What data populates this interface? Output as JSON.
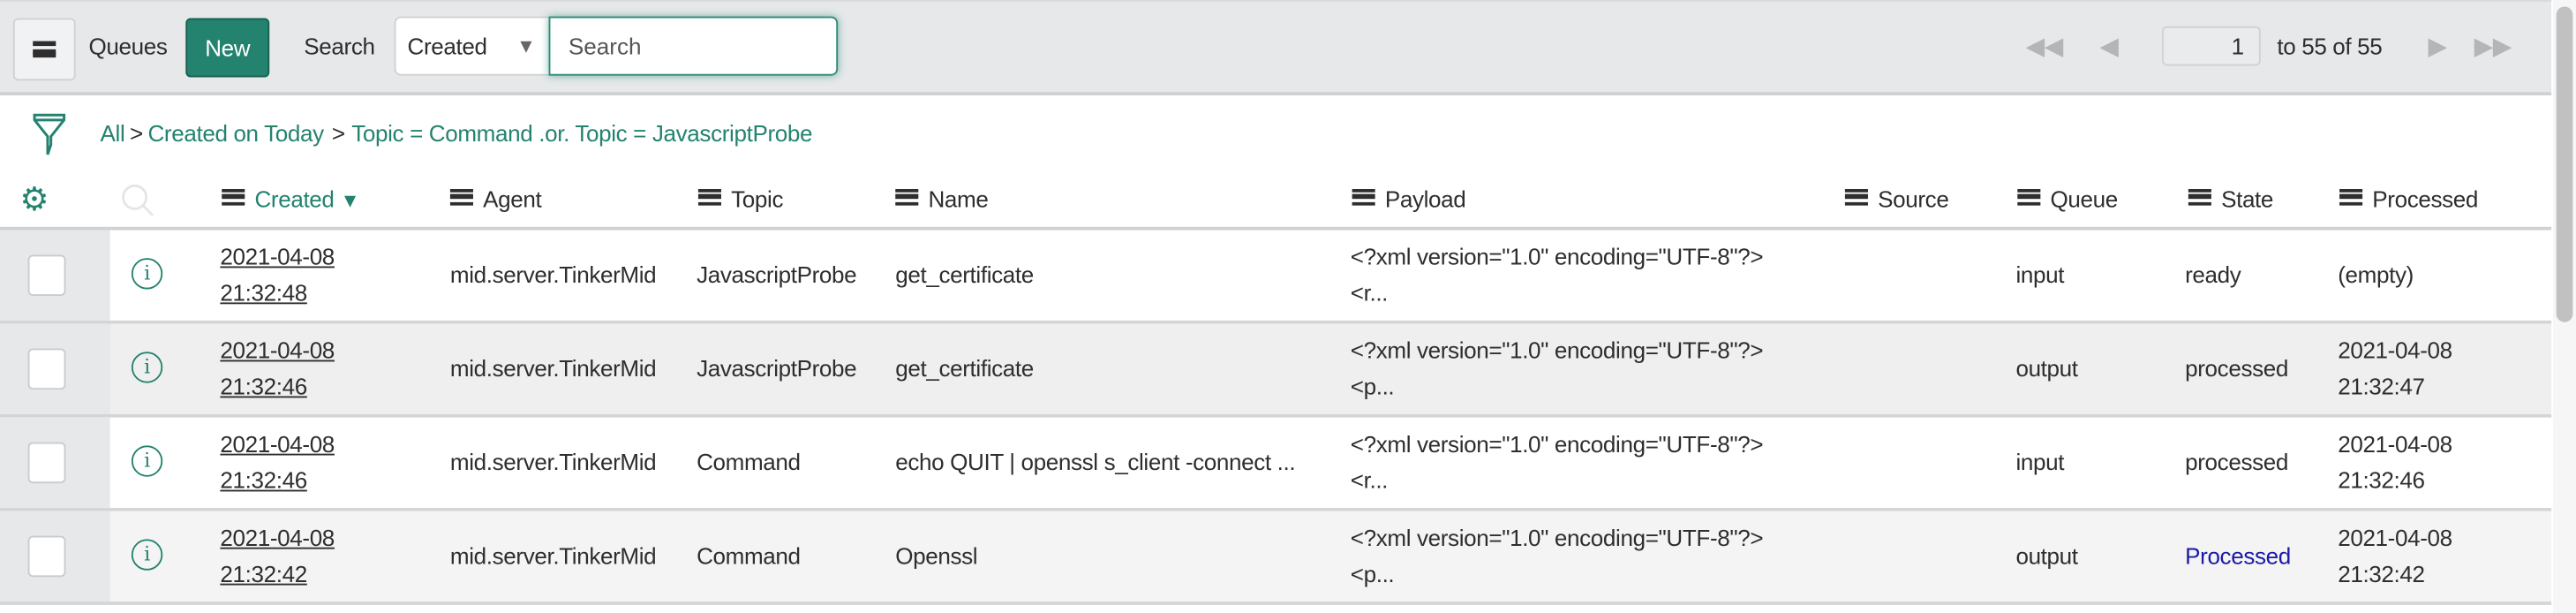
{
  "toolbar": {
    "menu_icon": "hamburger-icon",
    "title": "Queues",
    "new_label": "New",
    "search_label": "Search",
    "search_field": "Created",
    "search_placeholder": "Search",
    "pagination": {
      "page_value": "1",
      "range_text": "to 55 of 55"
    }
  },
  "breadcrumb": {
    "items": [
      "All",
      "Created on Today",
      "Topic = Command .or. Topic = JavascriptProbe"
    ],
    "separator": ">"
  },
  "columns": {
    "created": "Created",
    "agent": "Agent",
    "topic": "Topic",
    "name": "Name",
    "payload": "Payload",
    "source": "Source",
    "queue": "Queue",
    "state": "State",
    "processed": "Processed"
  },
  "sort_indicator": "▼",
  "colors": {
    "accent": "#23836f",
    "link_blue": "#1a1aa6"
  },
  "rows": [
    {
      "date": "2021-04-08",
      "time": "21:32:48",
      "agent": "mid.server.TinkerMid",
      "topic": "JavascriptProbe",
      "name": "get_certificate",
      "payload1": "<?xml version=\"1.0\" encoding=\"UTF-8\"?>",
      "payload2": "<r...",
      "source": "",
      "queue": "input",
      "state": "ready",
      "processed1": "(empty)",
      "processed2": ""
    },
    {
      "date": "2021-04-08",
      "time": "21:32:46",
      "agent": "mid.server.TinkerMid",
      "topic": "JavascriptProbe",
      "name": "get_certificate",
      "payload1": "<?xml version=\"1.0\" encoding=\"UTF-8\"?>",
      "payload2": "<p...",
      "source": "",
      "queue": "output",
      "state": "processed",
      "processed1": "2021-04-08",
      "processed2": "21:32:47"
    },
    {
      "date": "2021-04-08",
      "time": "21:32:46",
      "agent": "mid.server.TinkerMid",
      "topic": "Command",
      "name": "echo QUIT | openssl s_client -connect ...",
      "payload1": "<?xml version=\"1.0\" encoding=\"UTF-8\"?>",
      "payload2": "<r...",
      "source": "",
      "queue": "input",
      "state": "processed",
      "processed1": "2021-04-08",
      "processed2": "21:32:46"
    },
    {
      "date": "2021-04-08",
      "time": "21:32:42",
      "agent": "mid.server.TinkerMid",
      "topic": "Command",
      "name": "Openssl",
      "payload1": "<?xml version=\"1.0\" encoding=\"UTF-8\"?>",
      "payload2": "<p...",
      "source": "",
      "queue": "output",
      "state": "Processed",
      "processed1": "2021-04-08",
      "processed2": "21:32:42"
    }
  ]
}
